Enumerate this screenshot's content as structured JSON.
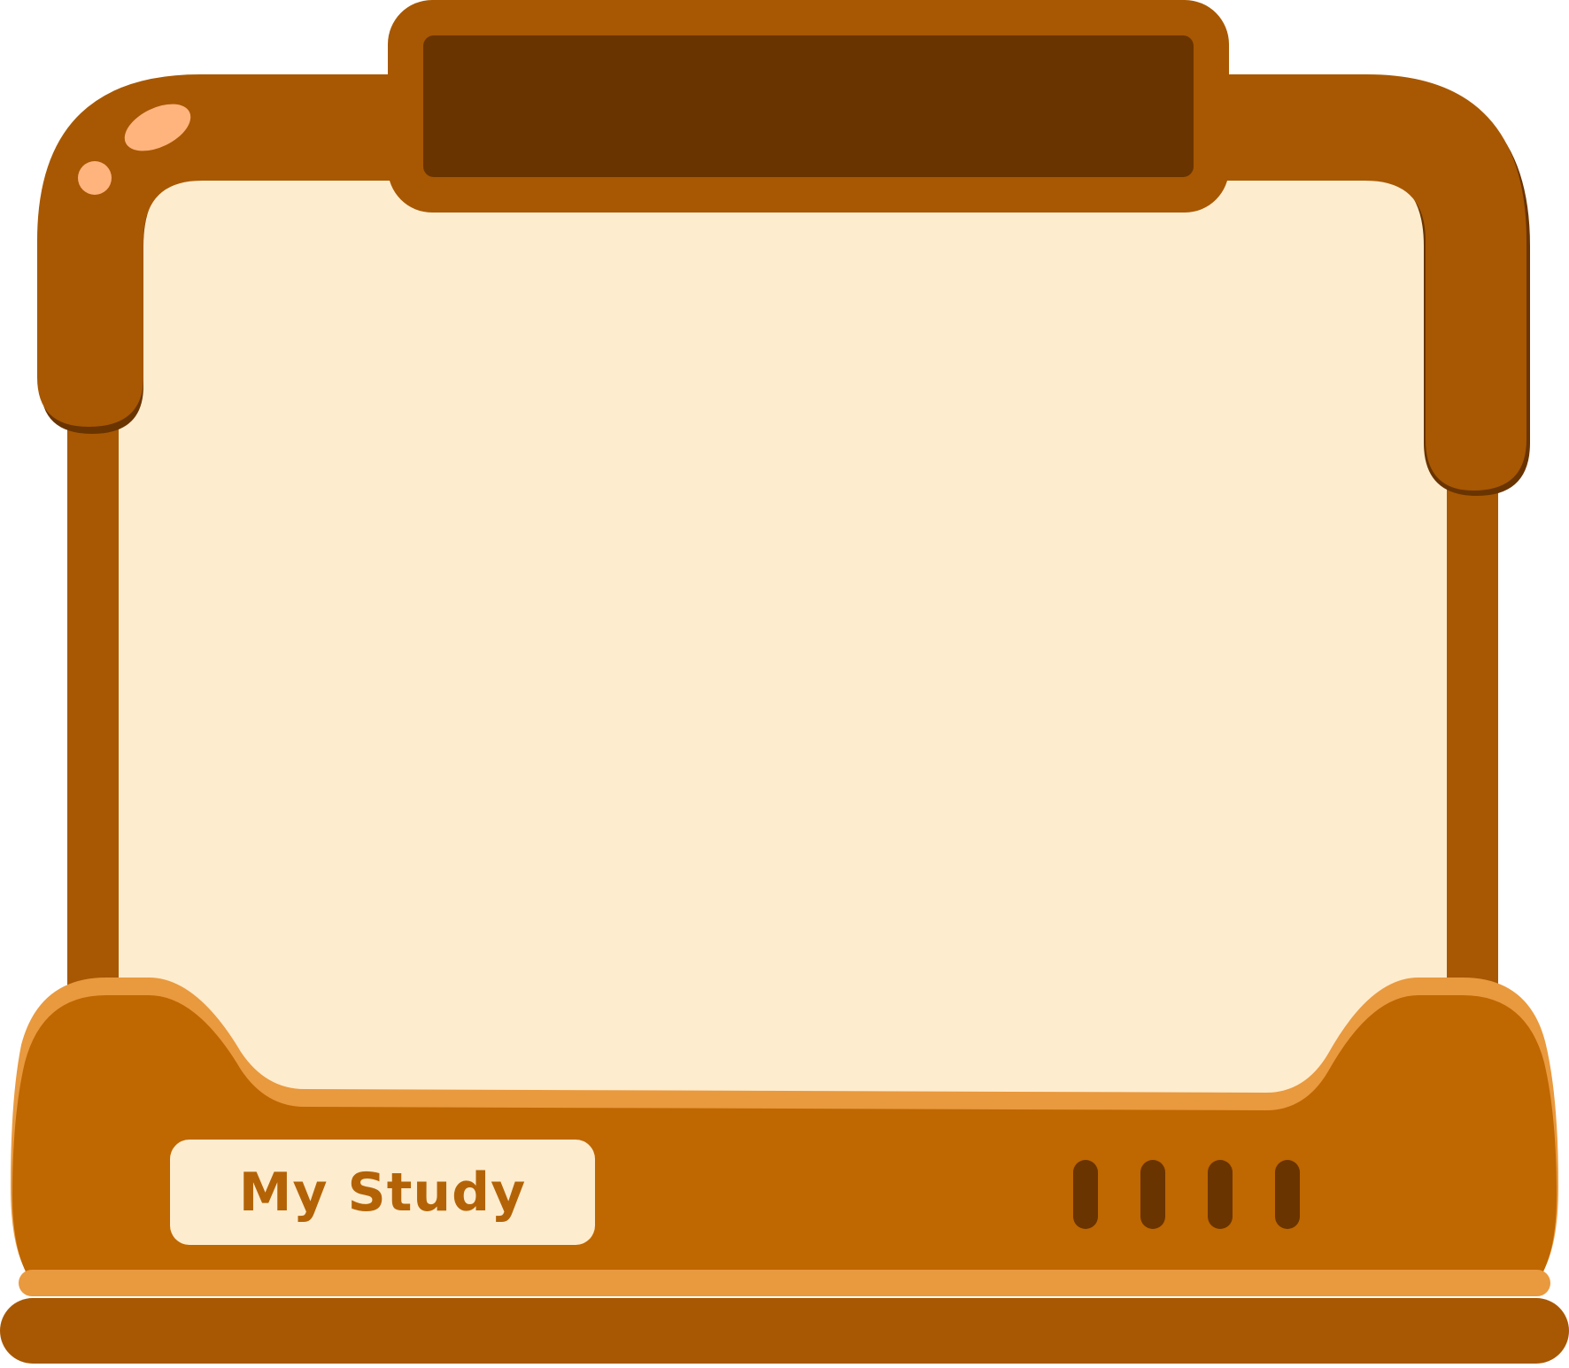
{
  "frame": {
    "label": "My Study",
    "vent_count": 4
  },
  "colors": {
    "frame_dark": "#A85802",
    "frame_shadow": "#6A3400",
    "plate": "#6A3400",
    "screen": "#FEECCE",
    "base": "#BF6700",
    "base_trim": "#E9993E",
    "highlight": "#FFB47E",
    "label_text": "#B36306"
  }
}
